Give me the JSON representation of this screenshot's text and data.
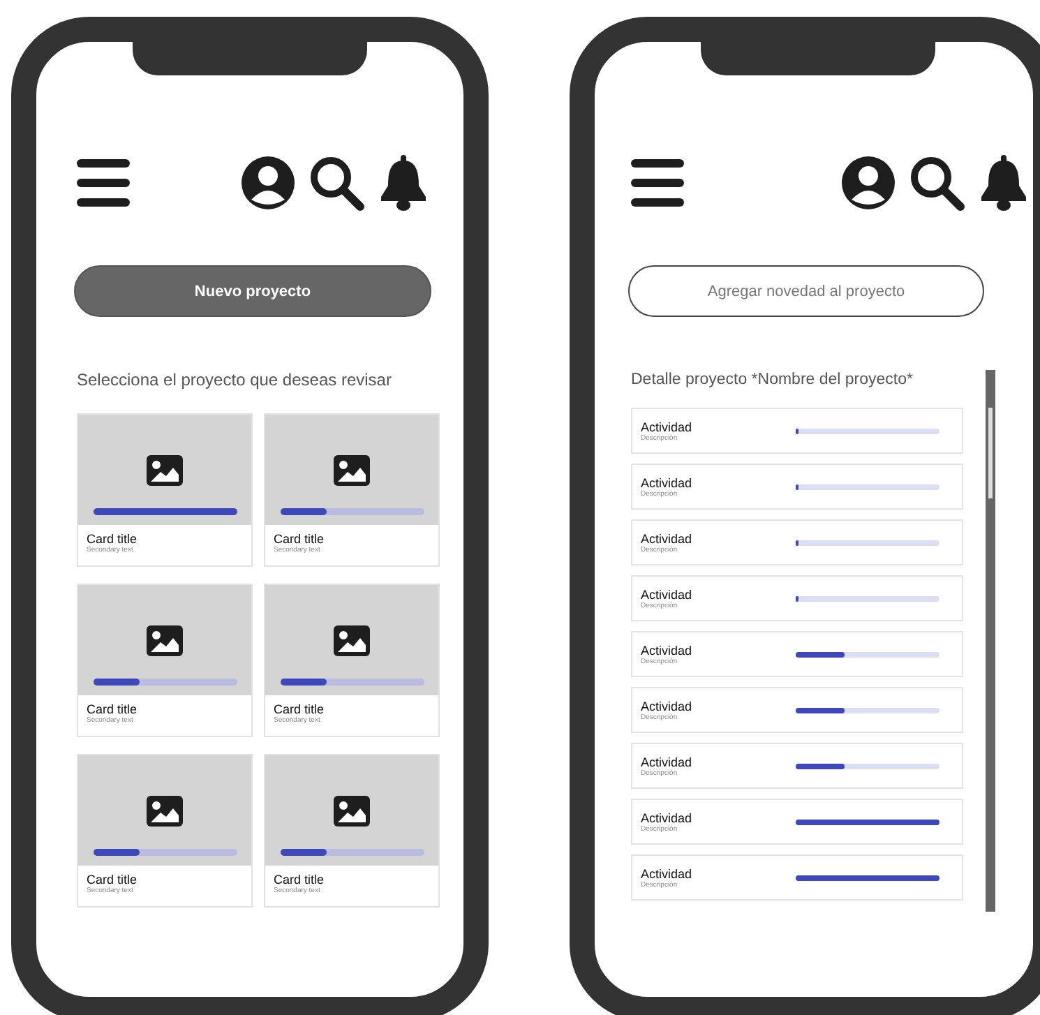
{
  "screens": [
    {
      "button": {
        "label": "Nuevo proyecto",
        "kind": "filled"
      },
      "heading": "Selecciona el proyecto que deseas revisar",
      "cards": [
        {
          "title": "Card title",
          "subtitle": "Secondary text",
          "level": 1
        },
        {
          "title": "Card title",
          "subtitle": "Secondary text",
          "level": 0.33
        },
        {
          "title": "Card title",
          "subtitle": "Secondary text",
          "level": 0.33
        },
        {
          "title": "Card title",
          "subtitle": "Secondary text",
          "level": 0.33
        },
        {
          "title": "Card title",
          "subtitle": "Secondary text",
          "level": 0.33
        },
        {
          "title": "Card title",
          "subtitle": "Secondary text",
          "level": 0.33
        }
      ]
    },
    {
      "button": {
        "label": "Agregar novedad al proyecto",
        "kind": "outlined"
      },
      "heading": "Detalle proyecto *Nombre del proyecto*",
      "activities": [
        {
          "title": "Actividad",
          "description": "Descripción",
          "level": 0.02
        },
        {
          "title": "Actividad",
          "description": "Descripción",
          "level": 0.02
        },
        {
          "title": "Actividad",
          "description": "Descripción",
          "level": 0.02
        },
        {
          "title": "Actividad",
          "description": "Descripción",
          "level": 0.02
        },
        {
          "title": "Actividad",
          "description": "Descripción",
          "level": 0.34
        },
        {
          "title": "Actividad",
          "description": "Descripción",
          "level": 0.34
        },
        {
          "title": "Actividad",
          "description": "Descripción",
          "level": 0.34
        },
        {
          "title": "Actividad",
          "description": "Descripción",
          "level": 1
        },
        {
          "title": "Actividad",
          "description": "Descripción",
          "level": 1
        }
      ]
    }
  ]
}
